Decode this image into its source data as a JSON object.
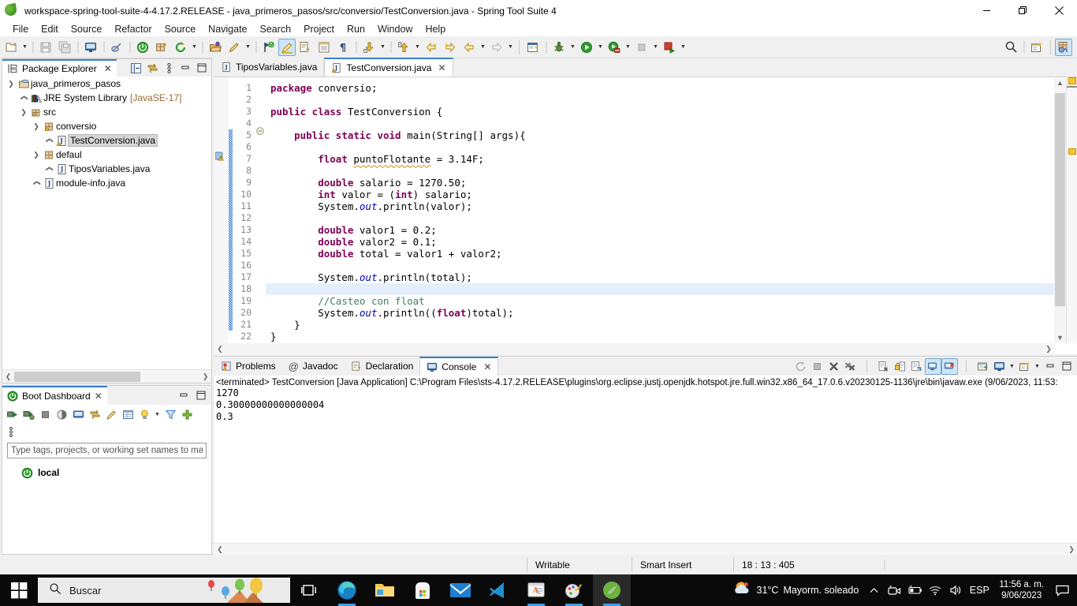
{
  "window": {
    "title": "workspace-spring-tool-suite-4-4.17.2.RELEASE - java_primeros_pasos/src/conversio/TestConversion.java - Spring Tool Suite 4",
    "app_icon": "spring-leaf-icon",
    "minimize": "minimize-icon",
    "maximize": "restore-icon",
    "close": "close-icon"
  },
  "menubar": {
    "items": [
      {
        "label": "File"
      },
      {
        "label": "Edit"
      },
      {
        "label": "Source"
      },
      {
        "label": "Refactor"
      },
      {
        "label": "Source"
      },
      {
        "label": "Navigate"
      },
      {
        "label": "Search"
      },
      {
        "label": "Project"
      },
      {
        "label": "Run"
      },
      {
        "label": "Window"
      },
      {
        "label": "Help"
      }
    ]
  },
  "toolbar": {
    "items": [
      {
        "name": "new-icon"
      },
      {
        "name": "new-dropdown-arrow"
      },
      {
        "name": "sep-1"
      },
      {
        "name": "save-icon"
      },
      {
        "name": "save-all-icon"
      },
      {
        "name": "sep-2"
      },
      {
        "name": "open-console-icon"
      },
      {
        "name": "sep-3"
      },
      {
        "name": "link-icon"
      },
      {
        "name": "sep-4"
      },
      {
        "name": "boot-run-icon"
      },
      {
        "name": "new-package-icon"
      },
      {
        "name": "spring-refresh-icon"
      },
      {
        "name": "spring-refresh-arrow"
      },
      {
        "name": "sep-5"
      },
      {
        "name": "open-type-icon"
      },
      {
        "name": "toggle-markoccurrences-icon"
      },
      {
        "name": "mark-dropdown-arrow"
      },
      {
        "name": "sep-6"
      },
      {
        "name": "search-type-icon"
      },
      {
        "name": "highlight-selected-icon"
      },
      {
        "name": "open-task-icon"
      },
      {
        "name": "show-whitespace-icon"
      },
      {
        "name": "pilcrow-icon"
      },
      {
        "name": "sep-7"
      },
      {
        "name": "download-icon"
      },
      {
        "name": "download-arrow"
      },
      {
        "name": "sep-8"
      },
      {
        "name": "upload-icon"
      },
      {
        "name": "upload-arrow"
      },
      {
        "name": "back-icon"
      },
      {
        "name": "forward-icon"
      },
      {
        "name": "prev-edit-icon"
      },
      {
        "name": "prev-edit-arrow"
      },
      {
        "name": "next-edit-icon"
      },
      {
        "name": "next-edit-arrow"
      },
      {
        "name": "bar-1"
      },
      {
        "name": "new-java-class-icon"
      },
      {
        "name": "sep-9"
      },
      {
        "name": "debug-icon"
      },
      {
        "name": "debug-arrow"
      },
      {
        "name": "run-icon"
      },
      {
        "name": "run-arrow"
      },
      {
        "name": "run-server-icon"
      },
      {
        "name": "run-server-arrow"
      },
      {
        "name": "stop-icon"
      },
      {
        "name": "stop-arrow"
      },
      {
        "name": "terminate-relaunch-icon"
      },
      {
        "name": "terminate-arrow"
      }
    ],
    "right_items": [
      {
        "name": "search-icon"
      },
      {
        "name": "sep-right"
      },
      {
        "name": "new-window-icon"
      },
      {
        "name": "bar-right"
      },
      {
        "name": "perspective-java-icon"
      }
    ]
  },
  "package_explorer": {
    "tab_label": "Package Explorer",
    "tab_icon": "package-explorer-icon",
    "close_icon": "close-icon",
    "tools": [
      {
        "name": "collapse-all-icon"
      },
      {
        "name": "link-with-editor-icon"
      },
      {
        "name": "view-menu-icon"
      },
      {
        "name": "minimize-icon"
      },
      {
        "name": "maximize-icon"
      }
    ],
    "tree": [
      {
        "label": "java_primeros_pasos",
        "sub": "",
        "depth": 0,
        "twist": "down",
        "icon": "java-project-icon",
        "selected": false
      },
      {
        "label": "JRE System Library",
        "sub": "[JavaSE-17]",
        "depth": 1,
        "twist": "right",
        "icon": "jre-library-icon",
        "selected": false
      },
      {
        "label": "src",
        "sub": "",
        "depth": 1,
        "twist": "down",
        "icon": "source-folder-icon",
        "selected": false
      },
      {
        "label": "conversio",
        "sub": "",
        "depth": 2,
        "twist": "down",
        "icon": "package-warning-icon",
        "selected": false
      },
      {
        "label": "TestConversion.java",
        "sub": "",
        "depth": 3,
        "twist": "right",
        "icon": "java-file-warning-icon",
        "selected": true
      },
      {
        "label": "defaul",
        "sub": "",
        "depth": 2,
        "twist": "down",
        "icon": "package-icon",
        "selected": false
      },
      {
        "label": "TiposVariables.java",
        "sub": "",
        "depth": 3,
        "twist": "right",
        "icon": "java-file-icon",
        "selected": false
      },
      {
        "label": "module-info.java",
        "sub": "",
        "depth": 2,
        "twist": "right",
        "icon": "java-file-icon",
        "selected": false
      }
    ]
  },
  "boot_dashboard": {
    "tab_label": "Boot Dashboard",
    "tab_icon": "spring-boot-icon",
    "close_icon": "close-icon",
    "tools": [
      {
        "name": "minimize-icon"
      },
      {
        "name": "maximize-icon"
      }
    ],
    "toolbar_icons": [
      {
        "name": "start-icon"
      },
      {
        "name": "debug-start-icon"
      },
      {
        "name": "stop-icon"
      },
      {
        "name": "redebug-icon"
      },
      {
        "name": "open-console-icon"
      },
      {
        "name": "link-with-editor-icon"
      },
      {
        "name": "edit-config-icon"
      },
      {
        "name": "open-properties-icon"
      },
      {
        "name": "bulb-icon"
      },
      {
        "name": "bulb-dropdown-arrow"
      },
      {
        "name": "filter-icon"
      },
      {
        "name": "add-icon"
      },
      {
        "name": "view-menu-icon"
      }
    ],
    "filter_placeholder": "Type tags, projects, or working set names to ma",
    "filter_value": "",
    "items": [
      {
        "label": "local",
        "icon": "spring-boot-icon"
      }
    ]
  },
  "editor": {
    "tabs": [
      {
        "label": "TiposVariables.java",
        "icon": "java-file-icon",
        "active": false,
        "closeable": false
      },
      {
        "label": "TestConversion.java",
        "icon": "java-file-warning-icon",
        "active": true,
        "closeable": true,
        "close_icon": "close-icon"
      }
    ],
    "warning_marker": "warning-icon",
    "fold_marker": "collapse-fold-icon",
    "current_line": 18,
    "change_bar_from": 5,
    "change_bar_to": 21,
    "lines": [
      {
        "n": 1,
        "tokens": [
          {
            "t": "package ",
            "c": "kw"
          },
          {
            "t": "conversio;",
            "c": "pl"
          }
        ]
      },
      {
        "n": 2,
        "tokens": []
      },
      {
        "n": 3,
        "tokens": [
          {
            "t": "public class ",
            "c": "kw"
          },
          {
            "t": "TestConversion {",
            "c": "pl"
          }
        ]
      },
      {
        "n": 4,
        "tokens": []
      },
      {
        "n": 5,
        "tokens": [
          {
            "t": "    ",
            "c": "pl"
          },
          {
            "t": "public static void ",
            "c": "kw"
          },
          {
            "t": "main(String[] args){",
            "c": "pl"
          }
        ]
      },
      {
        "n": 6,
        "tokens": []
      },
      {
        "n": 7,
        "tokens": [
          {
            "t": "        ",
            "c": "pl"
          },
          {
            "t": "float ",
            "c": "kw"
          },
          {
            "t": "puntoFlotante",
            "c": "warn"
          },
          {
            "t": " = 3.14F;",
            "c": "pl"
          }
        ]
      },
      {
        "n": 8,
        "tokens": []
      },
      {
        "n": 9,
        "tokens": [
          {
            "t": "        ",
            "c": "pl"
          },
          {
            "t": "double ",
            "c": "kw"
          },
          {
            "t": "salario = 1270.50;",
            "c": "pl"
          }
        ]
      },
      {
        "n": 10,
        "tokens": [
          {
            "t": "        ",
            "c": "pl"
          },
          {
            "t": "int ",
            "c": "kw"
          },
          {
            "t": "valor = (",
            "c": "pl"
          },
          {
            "t": "int",
            "c": "kw"
          },
          {
            "t": ") salario;",
            "c": "pl"
          }
        ]
      },
      {
        "n": 11,
        "tokens": [
          {
            "t": "        System.",
            "c": "pl"
          },
          {
            "t": "out",
            "c": "fld"
          },
          {
            "t": ".println(valor);",
            "c": "pl"
          }
        ]
      },
      {
        "n": 12,
        "tokens": []
      },
      {
        "n": 13,
        "tokens": [
          {
            "t": "        ",
            "c": "pl"
          },
          {
            "t": "double ",
            "c": "kw"
          },
          {
            "t": "valor1 = 0.2;",
            "c": "pl"
          }
        ]
      },
      {
        "n": 14,
        "tokens": [
          {
            "t": "        ",
            "c": "pl"
          },
          {
            "t": "double ",
            "c": "kw"
          },
          {
            "t": "valor2 = 0.1;",
            "c": "pl"
          }
        ]
      },
      {
        "n": 15,
        "tokens": [
          {
            "t": "        ",
            "c": "pl"
          },
          {
            "t": "double ",
            "c": "kw"
          },
          {
            "t": "total = valor1 + valor2;",
            "c": "pl"
          }
        ]
      },
      {
        "n": 16,
        "tokens": []
      },
      {
        "n": 17,
        "tokens": [
          {
            "t": "        System.",
            "c": "pl"
          },
          {
            "t": "out",
            "c": "fld"
          },
          {
            "t": ".println(total);",
            "c": "pl"
          }
        ]
      },
      {
        "n": 18,
        "tokens": []
      },
      {
        "n": 19,
        "tokens": [
          {
            "t": "        ",
            "c": "pl"
          },
          {
            "t": "//Casteo con float",
            "c": "cm"
          }
        ]
      },
      {
        "n": 20,
        "tokens": [
          {
            "t": "        System.",
            "c": "pl"
          },
          {
            "t": "out",
            "c": "fld"
          },
          {
            "t": ".println((",
            "c": "pl"
          },
          {
            "t": "float",
            "c": "kw"
          },
          {
            "t": ")total);",
            "c": "pl"
          }
        ]
      },
      {
        "n": 21,
        "tokens": [
          {
            "t": "    }",
            "c": "pl"
          }
        ]
      },
      {
        "n": 22,
        "tokens": [
          {
            "t": "}",
            "c": "pl"
          }
        ]
      }
    ]
  },
  "console_panel": {
    "tabs": [
      {
        "label": "Problems",
        "icon": "problems-icon",
        "active": false
      },
      {
        "label": "Javadoc",
        "icon": "javadoc-icon",
        "active": false
      },
      {
        "label": "Declaration",
        "icon": "declaration-icon",
        "active": false
      },
      {
        "label": "Console",
        "icon": "console-icon",
        "active": true,
        "close_icon": "close-icon"
      }
    ],
    "tools": [
      {
        "name": "relaunch-icon",
        "selected": false
      },
      {
        "name": "terminate-icon",
        "selected": false
      },
      {
        "name": "remove-launch-icon",
        "selected": false
      },
      {
        "name": "remove-all-terminated-icon",
        "selected": false
      },
      {
        "name": "bar-1"
      },
      {
        "name": "clear-console-icon",
        "selected": false
      },
      {
        "name": "scroll-lock-icon",
        "selected": false
      },
      {
        "name": "word-wrap-icon",
        "selected": false
      },
      {
        "name": "show-console-on-output-icon",
        "selected": true
      },
      {
        "name": "show-console-on-error-icon",
        "selected": true
      },
      {
        "name": "bar-2"
      },
      {
        "name": "pin-console-icon",
        "selected": false
      },
      {
        "name": "display-selected-console-icon",
        "selected": false
      },
      {
        "name": "display-console-arrow"
      },
      {
        "name": "open-console-icon",
        "selected": false
      },
      {
        "name": "open-console-arrow"
      },
      {
        "name": "minimize-icon"
      },
      {
        "name": "maximize-icon"
      }
    ],
    "header": "<terminated> TestConversion [Java Application] C:\\Program Files\\sts-4.17.2.RELEASE\\plugins\\org.eclipse.justj.openjdk.hotspot.jre.full.win32.x86_64_17.0.6.v20230125-1136\\jre\\bin\\javaw.exe  (9/06/2023, 11:53:",
    "output": [
      "1270",
      "0.30000000000000004",
      "0.3"
    ]
  },
  "statusbar": {
    "writable": "Writable",
    "insert_mode": "Smart Insert",
    "position": "18 : 13 : 405"
  },
  "taskbar": {
    "start_icon": "windows-start-icon",
    "search_placeholder": "Buscar",
    "search_value": "",
    "search_icon": "search-icon",
    "apps": [
      {
        "name": "task-view-icon",
        "running": false
      },
      {
        "name": "microsoft-edge-icon",
        "running": true
      },
      {
        "name": "file-explorer-icon",
        "running": false
      },
      {
        "name": "microsoft-store-icon",
        "running": false
      },
      {
        "name": "mail-icon",
        "running": false
      },
      {
        "name": "visual-studio-code-icon",
        "running": false
      },
      {
        "name": "word-icon",
        "running": true
      },
      {
        "name": "paint-icon",
        "running": true
      },
      {
        "name": "spring-tool-suite-icon",
        "running": true,
        "active": true
      }
    ],
    "tray": {
      "weather_icon": "partly-cloudy-icon",
      "temperature": "31°C",
      "condition": "Mayorm. soleado",
      "show_hidden_icon": "chevron-up-icon",
      "icons": [
        {
          "name": "camera-icon"
        },
        {
          "name": "battery-icon"
        },
        {
          "name": "wifi-icon"
        },
        {
          "name": "volume-icon"
        }
      ],
      "language": "ESP",
      "time": "11:56 a. m.",
      "date": "9/06/2023",
      "action_center_icon": "notification-icon"
    }
  },
  "colors": {
    "accent_blue": "#3a7fd5",
    "keyword_purple": "#7f0055",
    "comment_green": "#3f7f5f",
    "field_blue": "#0000c0",
    "selection_blue": "#cde5f7",
    "current_line": "#e4effb",
    "warning_yellow": "#ffc425",
    "spring_green": "#6db33f"
  }
}
